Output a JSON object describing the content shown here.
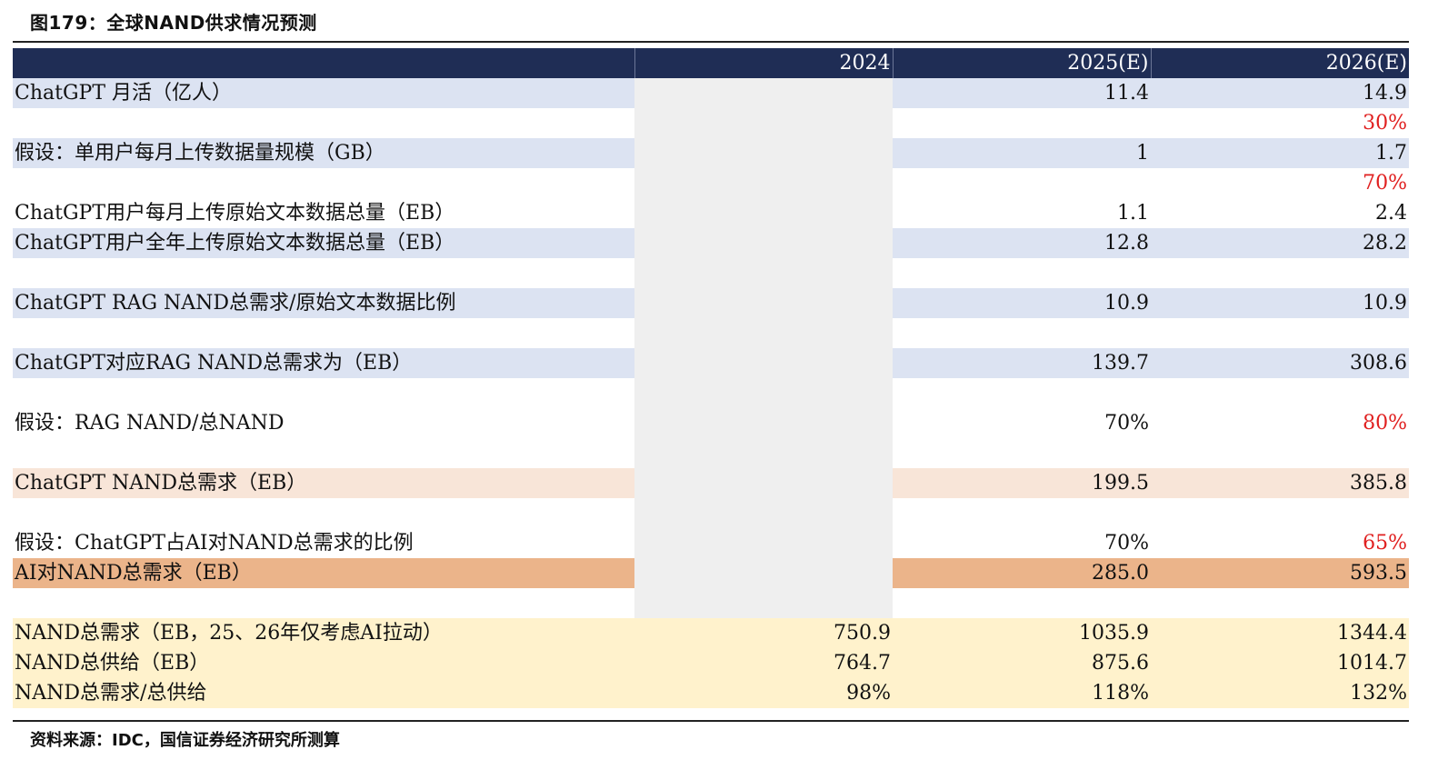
{
  "title": "图179：全球NAND供求情况预测",
  "header": [
    "",
    "2024",
    "2025(E)",
    "2026(E)"
  ],
  "rows": [
    {
      "label": "ChatGPT 月活（亿人）",
      "v2024": "",
      "v2025": "11.4",
      "v2026": "14.9",
      "style": "blue"
    },
    {
      "label": "",
      "v2024": "",
      "v2025": "",
      "v2026": "30%",
      "style": "white",
      "red2026": true
    },
    {
      "label": "假设：单用户每月上传数据量规模（GB）",
      "v2024": "",
      "v2025": "1",
      "v2026": "1.7",
      "style": "blue"
    },
    {
      "label": "",
      "v2024": "",
      "v2025": "",
      "v2026": "70%",
      "style": "white",
      "red2026": true
    },
    {
      "label": "ChatGPT用户每月上传原始文本数据总量（EB）",
      "v2024": "",
      "v2025": "1.1",
      "v2026": "2.4",
      "style": "white"
    },
    {
      "label": "ChatGPT用户全年上传原始文本数据总量（EB）",
      "v2024": "",
      "v2025": "12.8",
      "v2026": "28.2",
      "style": "blue"
    },
    {
      "label": "",
      "v2024": "",
      "v2025": "",
      "v2026": "",
      "style": "white"
    },
    {
      "label": "ChatGPT RAG NAND总需求/原始文本数据比例",
      "v2024": "",
      "v2025": "10.9",
      "v2026": "10.9",
      "style": "blue"
    },
    {
      "label": "",
      "v2024": "",
      "v2025": "",
      "v2026": "",
      "style": "white"
    },
    {
      "label": "ChatGPT对应RAG NAND总需求为（EB）",
      "v2024": "",
      "v2025": "139.7",
      "v2026": "308.6",
      "style": "blue"
    },
    {
      "label": "",
      "v2024": "",
      "v2025": "",
      "v2026": "",
      "style": "white"
    },
    {
      "label": "假设：RAG NAND/总NAND",
      "v2024": "",
      "v2025": "70%",
      "v2026": "80%",
      "style": "white",
      "red2026": true
    },
    {
      "label": "",
      "v2024": "",
      "v2025": "",
      "v2026": "",
      "style": "white"
    },
    {
      "label": "ChatGPT NAND总需求（EB）",
      "v2024": "",
      "v2025": "199.5",
      "v2026": "385.8",
      "style": "peach"
    },
    {
      "label": "",
      "v2024": "",
      "v2025": "",
      "v2026": "",
      "style": "white"
    },
    {
      "label": "假设：ChatGPT占AI对NAND总需求的比例",
      "v2024": "",
      "v2025": "70%",
      "v2026": "65%",
      "style": "white",
      "red2026": true
    },
    {
      "label": "AI对NAND总需求（EB）",
      "v2024": "",
      "v2025": "285.0",
      "v2026": "593.5",
      "style": "orange"
    },
    {
      "label": "",
      "v2024": "",
      "v2025": "",
      "v2026": "",
      "style": "white"
    },
    {
      "label": "NAND总需求（EB，25、26年仅考虑AI拉动）",
      "v2024": "750.9",
      "v2025": "1035.9",
      "v2026": "1344.4",
      "style": "yellow"
    },
    {
      "label": "NAND总供给（EB）",
      "v2024": "764.7",
      "v2025": "875.6",
      "v2026": "1014.7",
      "style": "yellow"
    },
    {
      "label": "NAND总需求/总供给",
      "v2024": "98%",
      "v2025": "118%",
      "v2026": "132%",
      "style": "yellow"
    }
  ],
  "source": "资料来源：IDC，国信证券经济研究所测算",
  "colors": {
    "header_bg": "#1f2d55",
    "blue_row": "#dce3f2",
    "peach_row": "#f8e5d8",
    "orange_row": "#ebb48a",
    "yellow_row": "#fff2cc",
    "highlight_red": "#e02020"
  }
}
